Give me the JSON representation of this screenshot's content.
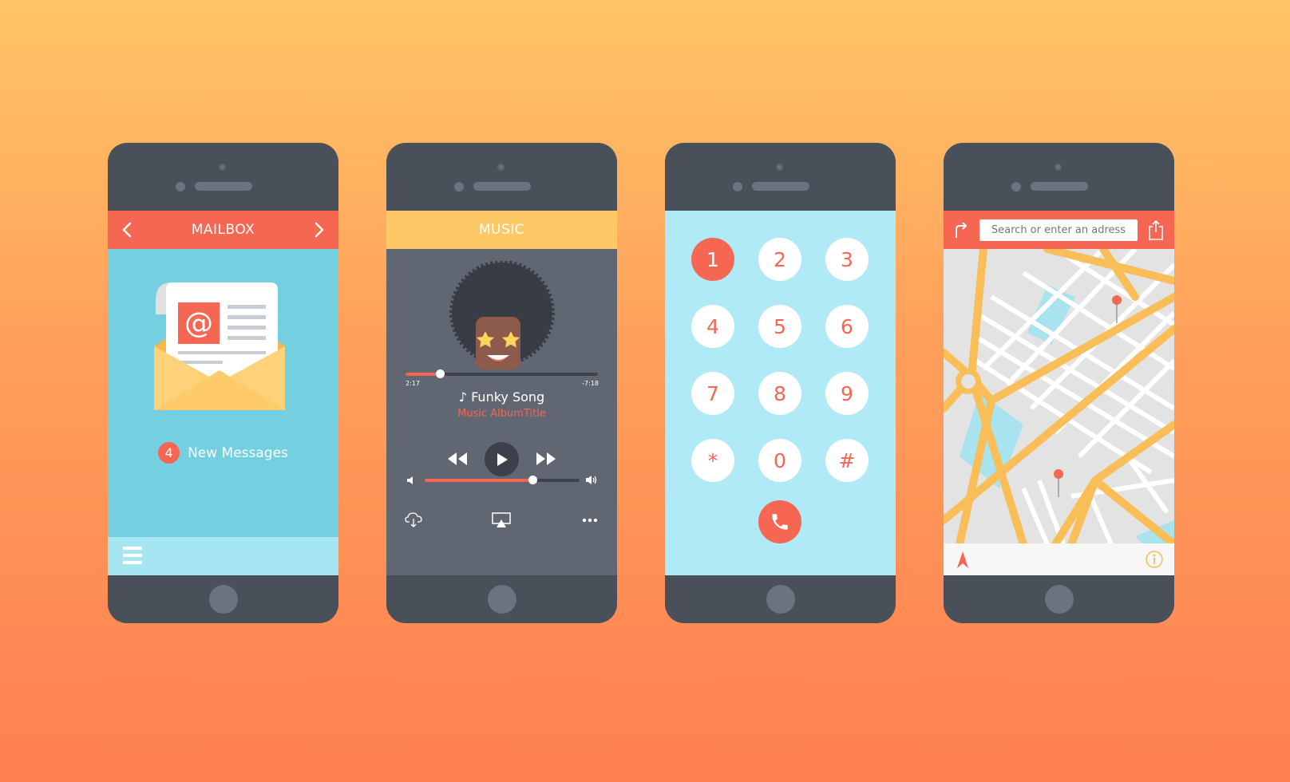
{
  "colors": {
    "accent": "#f56653",
    "music_header": "#ffc866",
    "mail_screen": "#74cfe0",
    "dialer_screen": "#b0eaf6",
    "phone_body": "#4a505a",
    "map_road": "#f9be58"
  },
  "mailbox": {
    "title": "MAILBOX",
    "new_count": "4",
    "new_label": "New Messages"
  },
  "music": {
    "title": "MUSIC",
    "elapsed": "2:17",
    "remaining": "-7:18",
    "progress": 0.18,
    "volume": 0.7,
    "song": "♪ Funky Song",
    "album": "Music AlbumTitle"
  },
  "dialer": {
    "keys": [
      "1",
      "2",
      "3",
      "4",
      "5",
      "6",
      "7",
      "8",
      "9",
      "*",
      "0",
      "#"
    ],
    "active_key": "1"
  },
  "map": {
    "search_placeholder": "Search or enter an adress"
  }
}
